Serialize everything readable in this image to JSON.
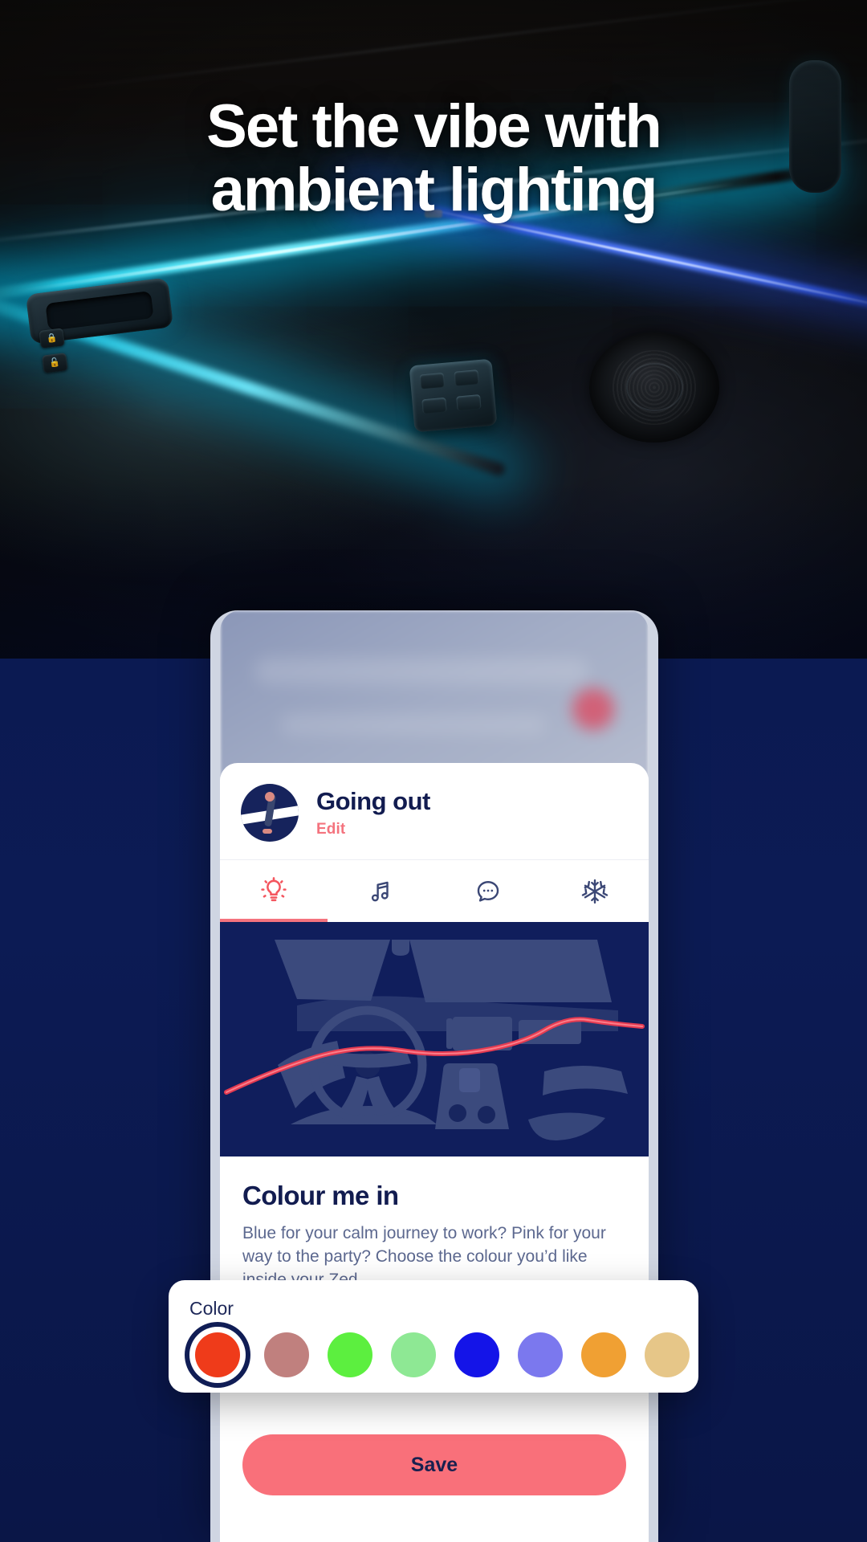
{
  "hero": {
    "headline_line1": "Set the vibe with",
    "headline_line2": "ambient lighting",
    "headline_full": "Set the vibe with ambient lighting",
    "scene": "car-interior-ambient-lighting-photo",
    "ambient_colors": {
      "cyan": "#2ad7f0",
      "blue": "#3a6af0"
    }
  },
  "phone": {
    "header": {
      "profile_name": "Going out",
      "edit_label": "Edit",
      "avatar": "person-walking-avatar"
    },
    "tabs": [
      {
        "id": "lighting",
        "icon": "lightbulb-icon",
        "active": true
      },
      {
        "id": "music",
        "icon": "music-note-icon",
        "active": false
      },
      {
        "id": "messages",
        "icon": "chat-bubble-icon",
        "active": false
      },
      {
        "id": "climate",
        "icon": "snowflake-icon",
        "active": false
      }
    ],
    "illustration": {
      "name": "car-dashboard-interior-illustration",
      "background": "#101e5c",
      "shape_color": "#3c4a7d",
      "light_strip_color": "#e8394f"
    },
    "content": {
      "heading": "Colour me in",
      "body": "Blue for your calm journey to work? Pink for your way to the party? Choose the colour you’d like inside your Zed."
    },
    "save_label": "Save"
  },
  "picker": {
    "label": "Color",
    "selected_index": 0,
    "swatches": [
      {
        "name": "red",
        "hex": "#ef3b1a"
      },
      {
        "name": "dusty-rose",
        "hex": "#c0807e"
      },
      {
        "name": "bright-green",
        "hex": "#5cef3f"
      },
      {
        "name": "light-green",
        "hex": "#8ee894"
      },
      {
        "name": "blue",
        "hex": "#1414e8"
      },
      {
        "name": "periwinkle",
        "hex": "#7b78ee"
      },
      {
        "name": "orange",
        "hex": "#f0a033"
      },
      {
        "name": "tan",
        "hex": "#e6c688"
      },
      {
        "name": "yellow",
        "hex": "#f6ec2e"
      },
      {
        "name": "pale-yellow",
        "hex": "#ece89a"
      },
      {
        "name": "cyan",
        "hex": "#3fd9e8"
      }
    ]
  },
  "theme": {
    "navy": "#0b1a52",
    "deep_navy": "#121c50",
    "coral": "#f4737e",
    "save_coral": "#f9707a",
    "muted_text": "#5c688f",
    "white": "#ffffff"
  }
}
